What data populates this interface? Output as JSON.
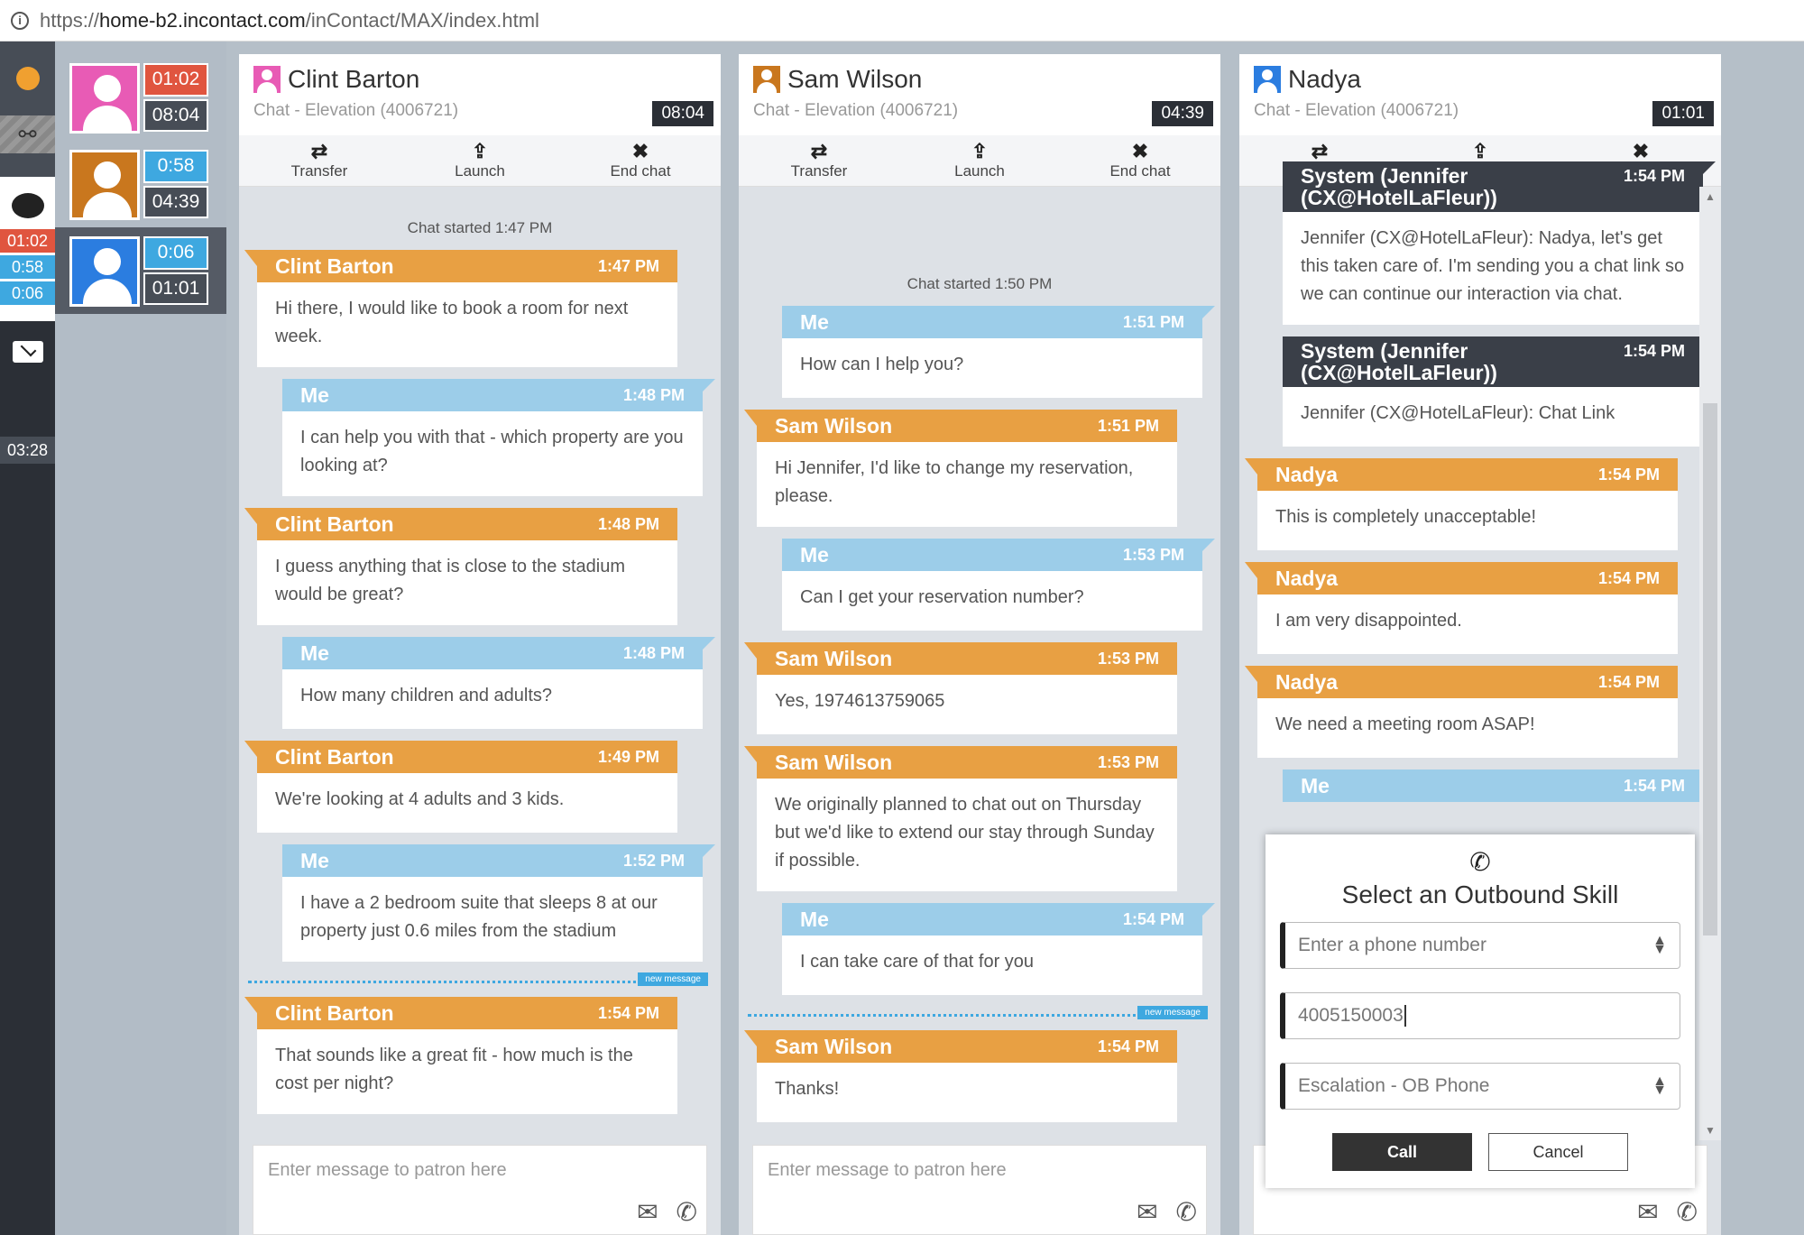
{
  "url": {
    "prefix": "https://",
    "host": "home-b2.incontact.com",
    "path": "/inContact/MAX/index.html"
  },
  "rail": {
    "timers": [
      {
        "v": "01:02",
        "c": "#e0553f"
      },
      {
        "v": "0:58",
        "c": "#3ea8e0"
      },
      {
        "v": "0:06",
        "c": "#3ea8e0"
      }
    ],
    "bottom_timer": "03:28"
  },
  "contacts": [
    {
      "color": "#e85bb5",
      "top": "01:02",
      "top_color": "#e0553f",
      "bottom": "08:04",
      "selected": false
    },
    {
      "color": "#c9771e",
      "top": "0:58",
      "top_color": "#3ea8e0",
      "bottom": "04:39",
      "selected": false
    },
    {
      "color": "#2b7de0",
      "top": "0:06",
      "top_color": "#3ea8e0",
      "bottom": "01:01",
      "selected": true
    }
  ],
  "toolbar": {
    "transfer": "Transfer",
    "launch": "Launch",
    "end_chat": "End chat"
  },
  "input_placeholder": "Enter message to patron here",
  "new_message": "new message",
  "columns": [
    {
      "name": "Clint Barton",
      "color": "#e85bb5",
      "sub": "Chat - Elevation (4006721)",
      "timer": "08:04",
      "started": "Chat started 1:47 PM",
      "started_gap": 36,
      "messages": [
        {
          "type": "cust",
          "from": "Clint Barton",
          "time": "1:47 PM",
          "text": "Hi there, I would like to book a room for next week."
        },
        {
          "type": "me",
          "from": "Me",
          "time": "1:48 PM",
          "text": "I can help you with that - which property are you looking at?"
        },
        {
          "type": "cust",
          "from": "Clint Barton",
          "time": "1:48 PM",
          "text": "I guess anything that is close to the stadium would be great?"
        },
        {
          "type": "me",
          "from": "Me",
          "time": "1:48 PM",
          "text": "How many children and adults?"
        },
        {
          "type": "cust",
          "from": "Clint Barton",
          "time": "1:49 PM",
          "text": "We're looking at 4 adults and 3 kids."
        },
        {
          "type": "me",
          "from": "Me",
          "time": "1:52 PM",
          "text": "I have a 2 bedroom suite that sleeps 8 at our property just 0.6 miles from the stadium"
        },
        {
          "type": "new"
        },
        {
          "type": "cust",
          "from": "Clint Barton",
          "time": "1:54 PM",
          "text": "That sounds like a great fit - how much is the cost per night?"
        }
      ]
    },
    {
      "name": "Sam Wilson",
      "color": "#c9771e",
      "sub": "Chat - Elevation (4006721)",
      "timer": "04:39",
      "started": "Chat started 1:50 PM",
      "started_gap": 98,
      "messages": [
        {
          "type": "me",
          "from": "Me",
          "time": "1:51 PM",
          "text": "How can I help you?"
        },
        {
          "type": "cust",
          "from": "Sam Wilson",
          "time": "1:51 PM",
          "text": "Hi Jennifer, I'd like to change my reservation, please."
        },
        {
          "type": "me",
          "from": "Me",
          "time": "1:53 PM",
          "text": "Can I get your reservation number?"
        },
        {
          "type": "cust",
          "from": "Sam Wilson",
          "time": "1:53 PM",
          "text": "Yes, 1974613759065"
        },
        {
          "type": "cust",
          "from": "Sam Wilson",
          "time": "1:53 PM",
          "text": "We originally planned to chat out on Thursday but we'd like to extend our stay through Sunday if possible."
        },
        {
          "type": "me",
          "from": "Me",
          "time": "1:54 PM",
          "text": "I can take care of that for you"
        },
        {
          "type": "new"
        },
        {
          "type": "cust",
          "from": "Sam Wilson",
          "time": "1:54 PM",
          "text": "Thanks!"
        }
      ]
    },
    {
      "name": "Nadya",
      "color": "#2b7de0",
      "sub": "Chat - Elevation (4006721)",
      "timer": "01:01",
      "started": "",
      "started_gap": 0,
      "messages": [
        {
          "type": "sys",
          "from": "System (Jennifer (CX@HotelLaFleur))",
          "time": "1:54 PM",
          "text": "Jennifer (CX@HotelLaFleur): Nadya, let's get this taken care of. I'm sending you a chat link so we can continue our interaction via chat."
        },
        {
          "type": "sys",
          "from": "System (Jennifer (CX@HotelLaFleur))",
          "time": "1:54 PM",
          "text": "Jennifer (CX@HotelLaFleur): Chat Link"
        },
        {
          "type": "cust",
          "from": "Nadya",
          "time": "1:54 PM",
          "text": "This is completely unacceptable!"
        },
        {
          "type": "cust",
          "from": "Nadya",
          "time": "1:54 PM",
          "text": "I am very disappointed."
        },
        {
          "type": "cust",
          "from": "Nadya",
          "time": "1:54 PM",
          "text": "We need a meeting room ASAP!"
        },
        {
          "type": "me",
          "from": "Me",
          "time": "1:54 PM",
          "text": ""
        }
      ]
    }
  ],
  "dialog": {
    "title": "Select an Outbound Skill",
    "phone_select": "Enter a phone number",
    "phone_value": "4005150003",
    "skill_select": "Escalation - OB Phone",
    "call": "Call",
    "cancel": "Cancel"
  }
}
